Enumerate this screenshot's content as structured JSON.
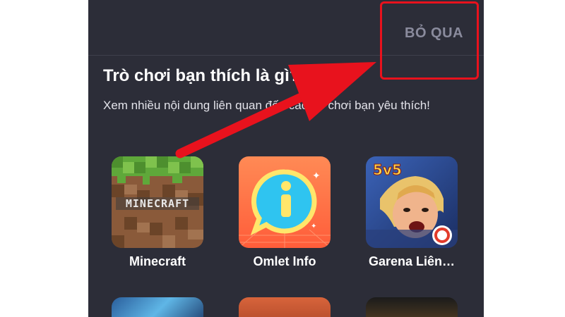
{
  "header": {
    "skip_label": "BỎ QUA"
  },
  "intro": {
    "title": "Trò chơi bạn thích là gì?",
    "description": "Xem nhiều nội dung liên quan đến các trò chơi bạn yêu thích!"
  },
  "games": [
    {
      "name": "Minecraft",
      "icon": "minecraft-icon",
      "logo_text": "MINECRAFT"
    },
    {
      "name": "Omlet Info",
      "icon": "omlet-info-icon"
    },
    {
      "name": "Garena Liên…",
      "icon": "garena-lien-quan-icon",
      "badge": "5v5"
    }
  ],
  "colors": {
    "background": "#2c2d38",
    "highlight": "#e8121d",
    "skip_text": "#8a8b9d"
  }
}
